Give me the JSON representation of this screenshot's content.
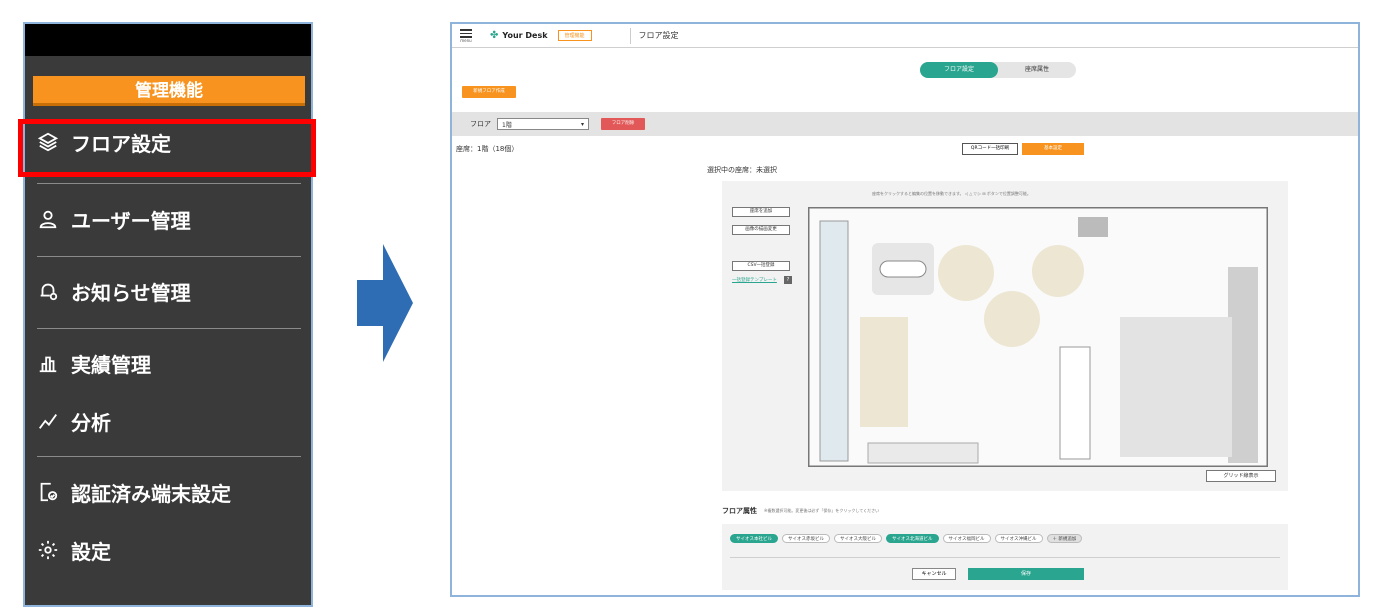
{
  "sidebar": {
    "admin_label": "管理機能",
    "items": [
      {
        "label": "フロア設定",
        "icon": "layers-icon"
      },
      {
        "label": "ユーザー管理",
        "icon": "user-icon"
      },
      {
        "label": "お知らせ管理",
        "icon": "bell-gear-icon"
      },
      {
        "label": "実績管理",
        "icon": "bar-chart-icon"
      },
      {
        "label": "分析",
        "icon": "line-chart-icon"
      },
      {
        "label": "認証済み端末設定",
        "icon": "device-check-icon"
      },
      {
        "label": "設定",
        "icon": "gear-icon"
      }
    ]
  },
  "app": {
    "menu_label": "menu",
    "brand": "Your Desk",
    "admin_tag": "管理機能",
    "page_title": "フロア設定",
    "tabs": [
      {
        "label": "フロア設定",
        "active": true
      },
      {
        "label": "座席属性",
        "active": false
      }
    ],
    "new_floor_button": "新規フロア作成",
    "floor_label": "フロア",
    "floor_value": "1階",
    "floor_delete_button": "フロア削除",
    "seat_count": "座席：1階（18個）",
    "qr_button": "QRコード一括印刷",
    "basic_button": "基本設定",
    "selected_seat": "選択中の座席：未選択",
    "map_hint": "座席をクリックすると編集の位置を移動できます。",
    "map_hint_tail": "ボタンで位置調整可能。",
    "tool_buttons": [
      "座席を追加",
      "画像の描画変更",
      "CSV一括登録"
    ],
    "template_link": "一括登録テンプレート",
    "grid_button": "グリッド線表示",
    "attr_title": "フロア属性",
    "attr_note": "※複数選択可能。変更後は必ず「保存」をクリックしてください",
    "chips": [
      {
        "label": "サイオス本社ビル",
        "active": true
      },
      {
        "label": "サイオス赤坂ビル",
        "active": false
      },
      {
        "label": "サイオス大阪ビル",
        "active": false
      },
      {
        "label": "サイオス北海道ビル",
        "active": true
      },
      {
        "label": "サイオス福岡ビル",
        "active": false
      },
      {
        "label": "サイオス沖縄ビル",
        "active": false
      },
      {
        "label": "＋ 新規追加",
        "active": false
      }
    ],
    "cancel_button": "キャンセル",
    "save_button": "保存"
  },
  "colors": {
    "accent_orange": "#f7931e",
    "accent_teal": "#2aa58f",
    "highlight_red": "#ff0000",
    "arrow_blue": "#2e6db4",
    "sidebar_bg": "#3a3a3a"
  }
}
